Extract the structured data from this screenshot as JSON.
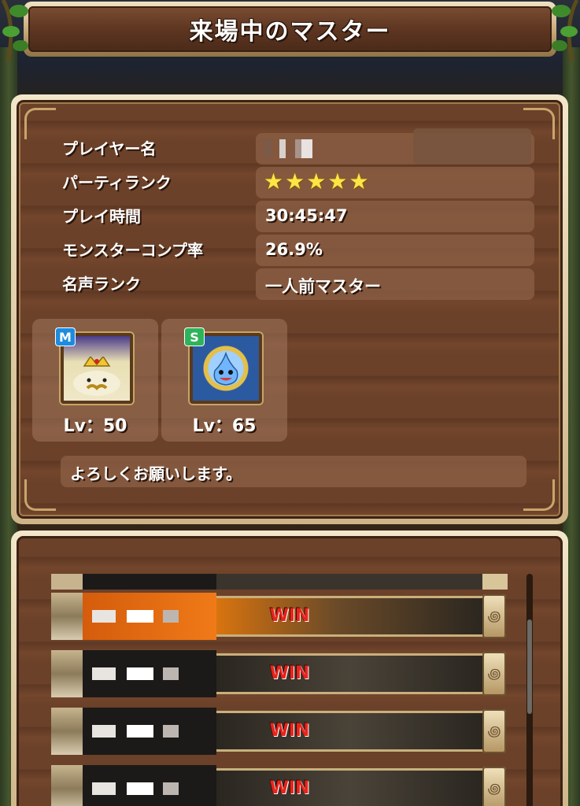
{
  "header": {
    "title": "来場中のマスター"
  },
  "profile": {
    "rows": [
      {
        "label": "プレイヤー名",
        "value": ""
      },
      {
        "label": "パーティランク",
        "stars": 5
      },
      {
        "label": "プレイ時間",
        "value": "30:45:47"
      },
      {
        "label": "モンスターコンプ率",
        "value": "26.9%"
      },
      {
        "label": "名声ランク",
        "value": "一人前マスター"
      }
    ],
    "monsters": [
      {
        "rank": "M",
        "level": "Lv：50",
        "icon": "king-slime-icon"
      },
      {
        "rank": "S",
        "level": "Lv：65",
        "icon": "metal-slime-icon"
      }
    ],
    "comment": "よろしくお願いします。"
  },
  "history": {
    "rows": [
      {
        "result": "WIN",
        "active": true
      },
      {
        "result": "WIN",
        "active": false
      },
      {
        "result": "WIN",
        "active": false
      },
      {
        "result": "WIN",
        "active": false
      }
    ],
    "cap_icon": "scroll-ornament-icon"
  },
  "colors": {
    "panel_wood": "#6b4129",
    "frame_cream": "#f3e7cb",
    "win_red": "#e8241c",
    "star_yellow": "#ffe545",
    "active_orange": "#f07a18"
  }
}
